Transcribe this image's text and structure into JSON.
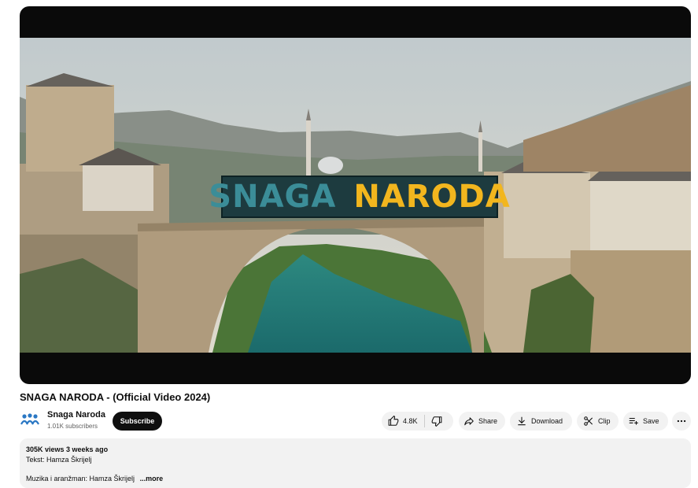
{
  "video": {
    "overlay_word1": "SNAGA",
    "overlay_word2": "NARODA",
    "title": "SNAGA NARODA - (Official Video 2024)"
  },
  "channel": {
    "name": "Snaga Naroda",
    "subscribers": "1.01K subscribers",
    "subscribe_label": "Subscribe"
  },
  "actions": {
    "likes": "4.8K",
    "share_label": "Share",
    "download_label": "Download",
    "clip_label": "Clip",
    "save_label": "Save"
  },
  "description": {
    "stats": "305K views  3 weeks ago",
    "line1": "Tekst: Hamza Škrijelj",
    "line2": "Muzika i aranžman: Hamza Škrijelj",
    "more_label": "...more"
  },
  "colors": {
    "overlay_bg": "#1d3b3f",
    "overlay_word1": "#3b8d98",
    "overlay_word2": "#f2b61e",
    "subscribe_bg": "#0f0f0f"
  },
  "icons": {
    "like": "thumbs-up-icon",
    "dislike": "thumbs-down-icon",
    "share": "share-arrow-icon",
    "download": "download-icon",
    "clip": "scissors-icon",
    "save": "playlist-add-icon",
    "more": "more-horizontal-icon"
  }
}
